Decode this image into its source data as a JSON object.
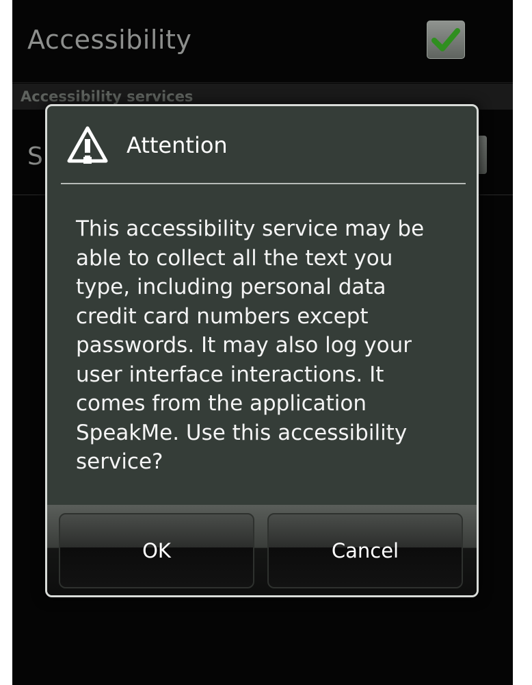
{
  "settings": {
    "title": "Accessibility",
    "section_header": "Accessibility services",
    "service_row_initial": "S"
  },
  "dialog": {
    "title": "Attention",
    "icon": "warning-icon",
    "message": "This accessibility service may be\nable to collect all the text you\ntype, including personal data\ncredit card numbers except\npasswords. It may also log your\nuser interface interactions. It\ncomes from the application\nSpeakMe. Use this accessibility\nservice?",
    "ok_label": "OK",
    "cancel_label": "Cancel"
  },
  "colors": {
    "dialog_background": "#353d38",
    "check_green": "#2f8f1f"
  }
}
